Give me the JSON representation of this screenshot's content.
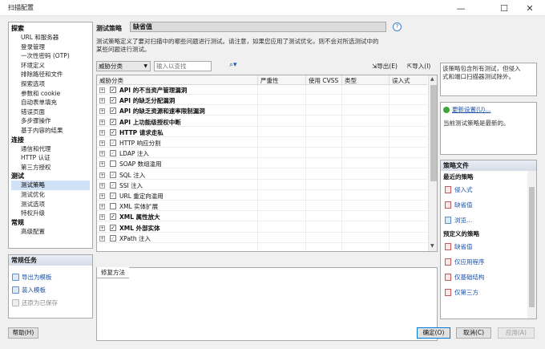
{
  "window": {
    "title": "扫描配置"
  },
  "nav": {
    "sections": [
      {
        "header": "探索",
        "items": [
          "URL 和服务器",
          "登录管理",
          "一次性密码 (OTP)",
          "环境定义",
          "排除路径和文件",
          "探索选项",
          "参数和 cookie",
          "自动表单填充",
          "错误页面",
          "多步骤操作",
          "基于内容的结果"
        ]
      },
      {
        "header": "连接",
        "items": [
          "通信和代理",
          "HTTP 认证",
          "第三方授权"
        ]
      },
      {
        "header": "测试",
        "items": [
          "测试策略",
          "测试优化",
          "测试选项",
          "特权升级"
        ]
      },
      {
        "header": "常规",
        "items": [
          "高级配置"
        ]
      }
    ],
    "selected": "测试策略"
  },
  "tasks": {
    "title": "常规任务",
    "items": [
      {
        "label": "导出为模板",
        "enabled": true
      },
      {
        "label": "装入模板",
        "enabled": true
      },
      {
        "label": "还原为已保存",
        "enabled": false
      }
    ]
  },
  "policy": {
    "label": "测试策略",
    "value": "缺省值",
    "help_icon": "?",
    "description_lines": [
      "测试策略定义了要对扫描中的哪些问题进行测试。请注意，如果您应用了测试优化，则不会对所选测试中的",
      "某些问题进行测试。"
    ]
  },
  "toolbar": {
    "filter": "威胁分类",
    "search_placeholder": "输入以查找",
    "find_icon": "⌕▾",
    "export": "导出(E)",
    "import": "导入(I)"
  },
  "grid": {
    "columns": [
      "威胁分类",
      "严重性",
      "使用 CVSS",
      "类型",
      "误入式"
    ],
    "rows": [
      {
        "label": "API 的不当资产管理漏洞",
        "checked": "checked"
      },
      {
        "label": "API 的缺乏分配漏洞",
        "checked": "checked"
      },
      {
        "label": "API 的缺乏资源和速率限制漏洞",
        "checked": "checked"
      },
      {
        "label": "API 上功能级授权中断",
        "checked": "checked"
      },
      {
        "label": "HTTP 请求走私",
        "checked": "checked"
      },
      {
        "label": "HTTP 响应分割",
        "checked": "partial"
      },
      {
        "label": "LDAP 注入",
        "checked": "partial"
      },
      {
        "label": "SOAP 数组滥用",
        "checked": "none"
      },
      {
        "label": "SQL 注入",
        "checked": "partial"
      },
      {
        "label": "SSI 注入",
        "checked": "partial"
      },
      {
        "label": "URL 重定向滥用",
        "checked": "partial"
      },
      {
        "label": "XML 实体扩展",
        "checked": "none"
      },
      {
        "label": "XML 属性放大",
        "checked": "checked"
      },
      {
        "label": "XML 外部实体",
        "checked": "checked"
      },
      {
        "label": "XPath 注入",
        "checked": "partial"
      }
    ]
  },
  "fix": {
    "tab": "修复方法"
  },
  "info": {
    "text_lines": [
      "该策略包含所有测试，但侵入",
      "式和端口扫描器测试除外。"
    ]
  },
  "update": {
    "link": "更新设置(U)...",
    "status": "当前测试策略是最新的。"
  },
  "policy_files": {
    "title": "策略文件",
    "recent_header": "最近的策略",
    "recent": [
      "侵入式",
      "缺省值",
      "浏览..."
    ],
    "predefined_header": "预定义的策略",
    "predefined": [
      "缺省值",
      "仅应用程序",
      "仅基础结构",
      "仅第三方"
    ]
  },
  "buttons": {
    "help": "帮助(H)",
    "ok": "确定(O)",
    "cancel": "取消(C)",
    "apply": "应用(A)"
  },
  "colors": {
    "selection": "#cfe2f7",
    "link": "#1a50a8",
    "accent": "#0078d7"
  }
}
